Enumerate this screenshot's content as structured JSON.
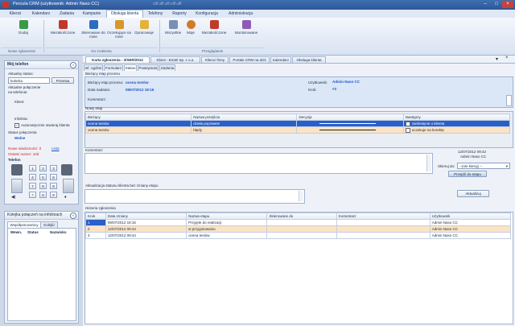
{
  "window": {
    "title": "Percula CRM (użytkownik: Admin Naso CC)",
    "quick_access": "ufff  ufff  ufff   ufff   ufff"
  },
  "menu_tabs": [
    "Klienci",
    "Kalendarz",
    "Zadania",
    "Kampanie",
    "Obsługa klienta",
    "Telefony",
    "Raporty",
    "Konfiguracja",
    "Administracja"
  ],
  "ribbon": {
    "buttons": [
      "Dodaj",
      "Niezakończone",
      "Skierowane do mnie",
      "Oczekujące na mnie",
      "Opracowuje",
      "Wszystkie",
      "Moje",
      "Niezakończone",
      "Monitorowane"
    ],
    "groups": [
      "Nowe zgłoszenie",
      "Do zrobienia",
      "Przeglądanie"
    ]
  },
  "my_phone": {
    "title": "Mój telefon",
    "current_status_label": "Aktualny status:",
    "current_status_value": "kołosko",
    "current_status_btn": "Przerwa",
    "current_conn_label": "Aktualne połączenie\nna telefonie:",
    "client_label": "Klient:",
    "info_label": "Infolinia:",
    "auto_search": "Automatycznie otwieraj klienta",
    "conn_status_label": "Status połączenia",
    "conn_status_value": "Wolne",
    "new_messages": "Nowe wiadomości: 0",
    "new_messages_link": "Lista",
    "last_number": "Ostatni numer: 10d",
    "phone_label": "Telefon",
    "keys": [
      "1",
      "2",
      "3",
      "4",
      "5",
      "6",
      "7",
      "8",
      "9",
      "*",
      "0",
      "#"
    ]
  },
  "queue": {
    "title": "Kolejka połączeń na infoliniach",
    "tabs": [
      "Współpracownicy",
      "Kolejki"
    ],
    "columns": [
      "Wewn.",
      "Status",
      "Nazwisko"
    ]
  },
  "doc_tabs": [
    "Karta zgłoszenia - 3/SER/2012",
    "Klient - Emtel Sp. z o.o.",
    "Klienci firmy",
    "Portale CRM na dziś",
    "Kalendarz",
    "Obsługa klienta"
  ],
  "sub_tabs": [
    "Inf. ogólne",
    "Formularz",
    "Status",
    "Powiązania",
    "Zadania"
  ],
  "current_stage": {
    "section_title": "Bieżący etap procesu",
    "stage_label": "Bieżący etap procesu:",
    "stage_value": "ocena testów",
    "date_label": "Data nadania:",
    "date_value": "09/07/2012 18:16",
    "comment_label": "Komentarz:",
    "user_label": "Użytkownik:",
    "user_value": "Admin Naso CC",
    "step_label": "Krok:",
    "step_value": "#3"
  },
  "new_stage": {
    "section_title": "Nowy etap",
    "columns": [
      "Bieżący",
      "Nazwa przejścia",
      "Decyzja",
      "Następny"
    ],
    "rows": [
      [
        "ocena testów",
        "dzieła poprawne",
        "",
        "zamknięcie u klienta"
      ],
      [
        "ocena testów",
        "błędy",
        "",
        "oczekuje na korektę"
      ]
    ],
    "comment_label": "Komentarz",
    "timestamp": "12/07/2012 09:42",
    "timestamp_user": "Admin Naso CC",
    "redirect_label": "Skieruj do:",
    "redirect_value": "--(nie kieruj) --",
    "go_button": "Przejdź do etapu"
  },
  "status_update": {
    "label": "Aktualizacja statusu klienta bez zmiany etapu",
    "button": "Aktualizuj"
  },
  "history": {
    "title": "Historia zgłoszenia",
    "columns": [
      "Krok",
      "Data zmiany",
      "Nazwa etapu",
      "Skierowane do",
      "Komentarz",
      "Użytkownik"
    ],
    "rows": [
      [
        "1",
        "09/07/2012 18:16",
        "Przyjęte do realizacji",
        "",
        "",
        "Admin Naso CC"
      ],
      [
        "2",
        "12/07/2012 09:44",
        "w przygotowaniu",
        "",
        "",
        "Admin Naso CC"
      ],
      [
        "3",
        "12/07/2012 09:44",
        "ocena testów",
        "",
        "",
        "Admin Naso CC"
      ]
    ]
  },
  "colors": {
    "selected_row": "#2a5fc9",
    "highlight_row": "#fbe3c4",
    "accent": "#3f6fb3"
  }
}
